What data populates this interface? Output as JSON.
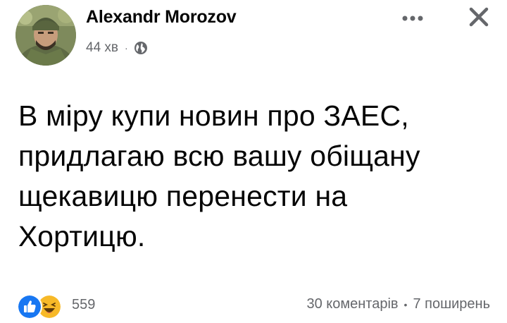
{
  "post": {
    "author": "Alexandr Morozov",
    "time": "44 хв",
    "meta_separator": "·",
    "privacy_icon": "globe-icon",
    "text": "В міру купи новин про ЗАЕС,\nпридлагаю всю вашу обіщану\nщекавицю перенести на\nХортицю."
  },
  "header_actions": {
    "more_icon": "more-horizontal-icon",
    "close_icon": "close-icon"
  },
  "reactions": {
    "types": [
      "like",
      "haha"
    ],
    "count": "559"
  },
  "stats": {
    "comments": "30 коментарів",
    "separator": "•",
    "shares": "7 поширень"
  },
  "colors": {
    "text": "#050505",
    "secondary": "#65676b",
    "like_blue": "#1877f2",
    "haha_yellow": "#f7b928"
  }
}
